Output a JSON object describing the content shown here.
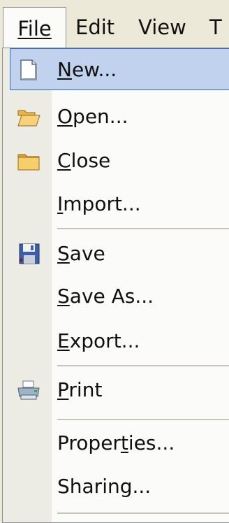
{
  "menubar": {
    "file": "File",
    "edit": "Edit",
    "view": "View",
    "tools": "T"
  },
  "menu": {
    "items": [
      {
        "label": "New...",
        "accel": "N",
        "icon": "new-document-icon"
      },
      {
        "label": "Open...",
        "accel": "O",
        "icon": "open-folder-icon"
      },
      {
        "label": "Close",
        "accel": "C",
        "icon": "closed-folder-icon"
      },
      {
        "label": "Import...",
        "accel": "I",
        "icon": ""
      },
      {
        "label": "Save",
        "accel": "S",
        "icon": "floppy-disk-icon"
      },
      {
        "label": "Save As...",
        "accel": "S",
        "icon": ""
      },
      {
        "label": "Export...",
        "accel": "E",
        "icon": ""
      },
      {
        "label": "Print",
        "accel": "P",
        "icon": "printer-icon"
      },
      {
        "label": "Properties...",
        "accel": "t",
        "icon": ""
      },
      {
        "label": "Sharing...",
        "accel": "",
        "icon": ""
      }
    ]
  },
  "colors": {
    "highlight_bg": "#c1d2ee",
    "highlight_border": "#316ac5",
    "gutter": "#ecebe4",
    "menu_bg": "#fbfbf9"
  }
}
